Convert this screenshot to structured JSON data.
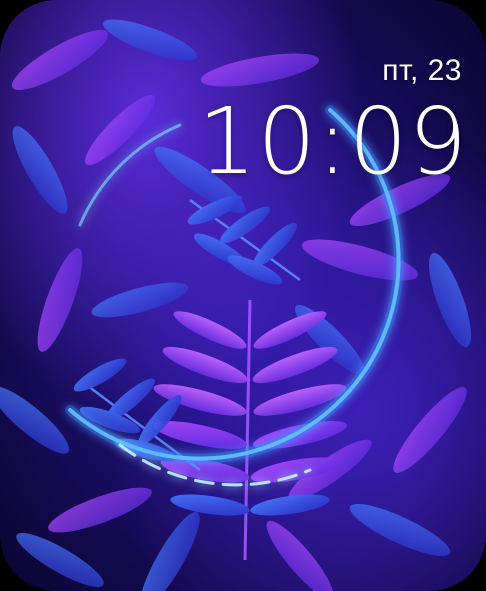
{
  "complication": {
    "date": "пт, 23",
    "time": "10:09"
  },
  "colors": {
    "background_deep": "#140a4f",
    "leaf_violet": "#8a3cf0",
    "leaf_blue": "#3c5cff",
    "ring_glow": "#7fe8ff"
  },
  "background": {
    "subject": "neon-ring-over-leaves-wallpaper"
  }
}
